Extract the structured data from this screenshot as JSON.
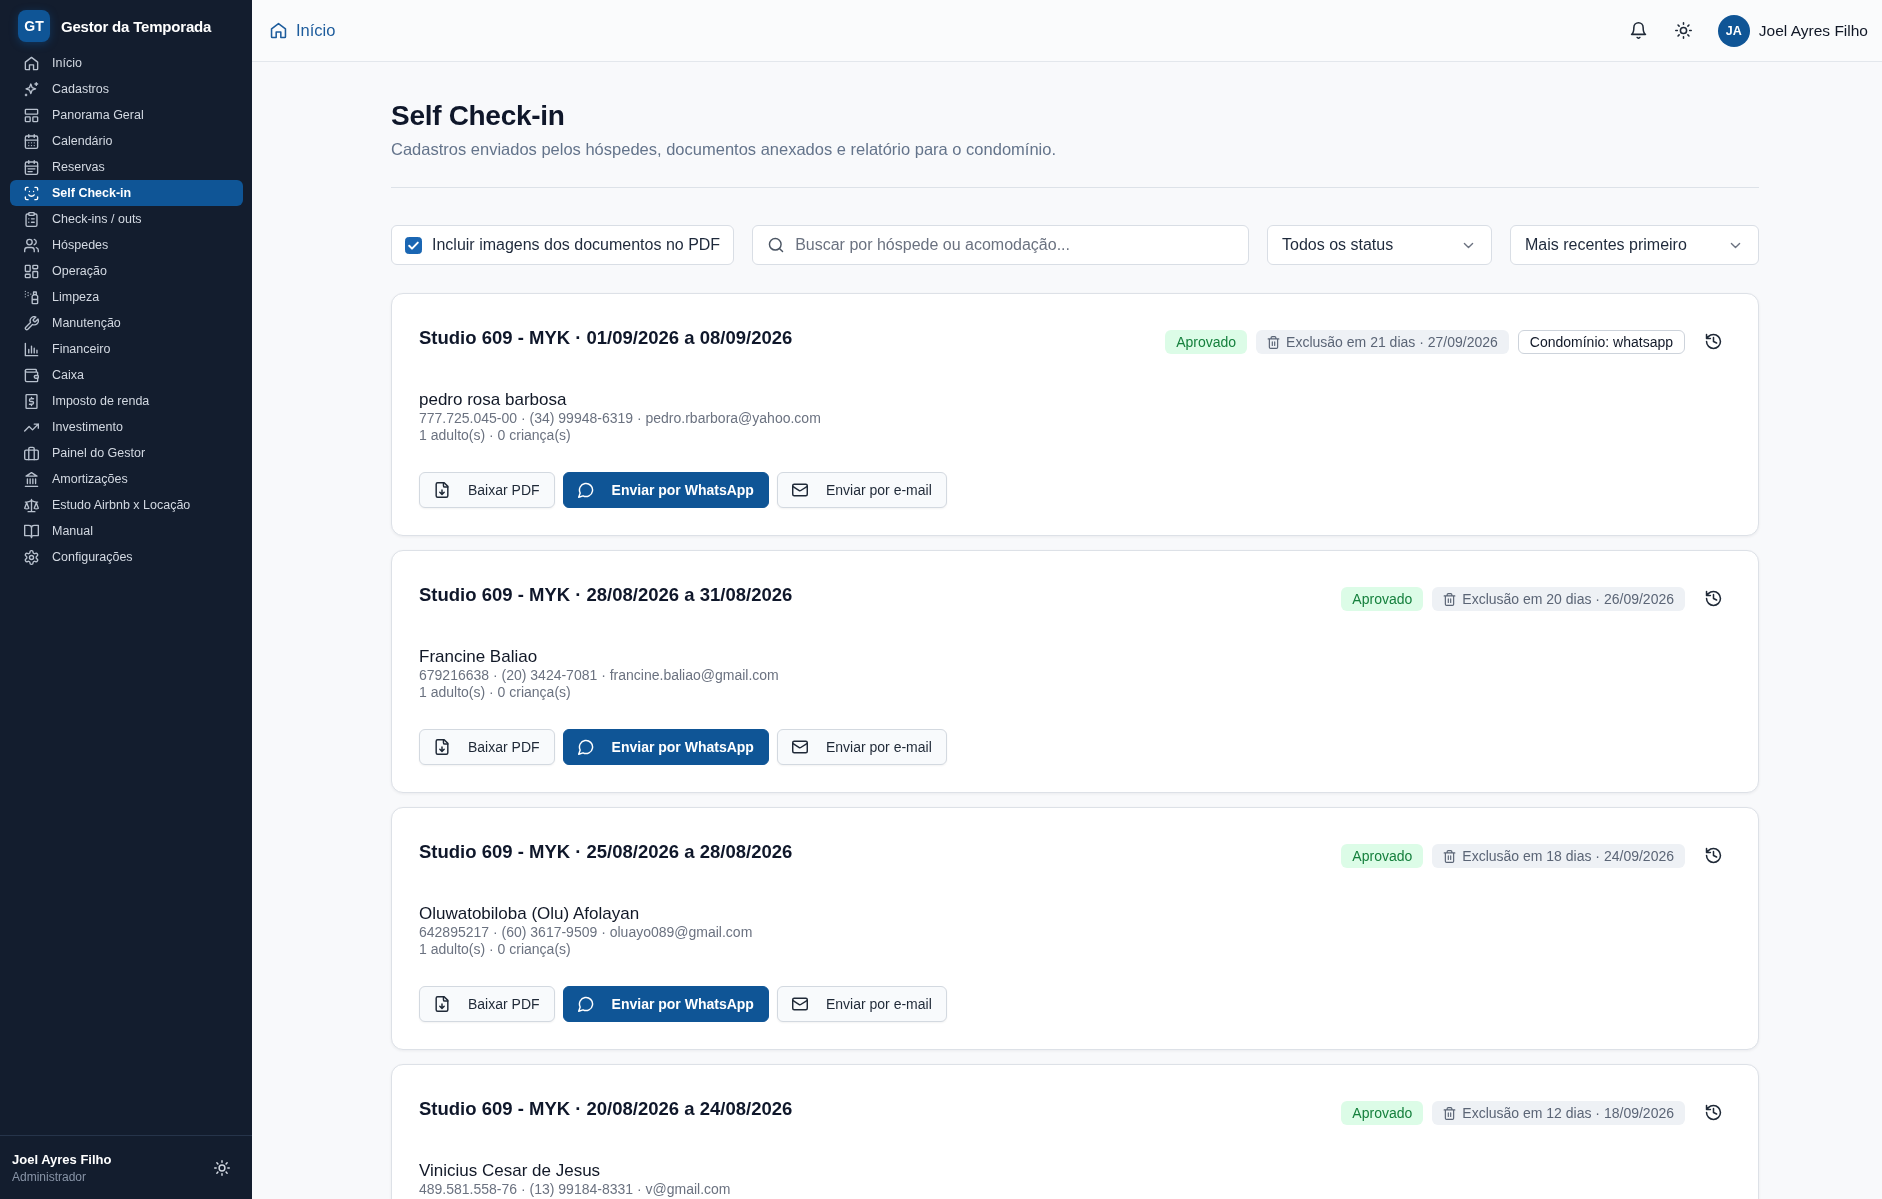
{
  "sidebar": {
    "logo": "GT",
    "title": "Gestor da Temporada",
    "items": [
      {
        "label": "Início",
        "selected": false
      },
      {
        "label": "Cadastros",
        "selected": false
      },
      {
        "label": "Panorama Geral",
        "selected": false
      },
      {
        "label": "Calendário",
        "selected": false
      },
      {
        "label": "Reservas",
        "selected": false
      },
      {
        "label": "Self Check-in",
        "selected": true
      },
      {
        "label": "Check-ins / outs",
        "selected": false
      },
      {
        "label": "Hóspedes",
        "selected": false
      },
      {
        "label": "Operação",
        "selected": false
      },
      {
        "label": "Limpeza",
        "selected": false
      },
      {
        "label": "Manutenção",
        "selected": false
      },
      {
        "label": "Financeiro",
        "selected": false
      },
      {
        "label": "Caixa",
        "selected": false
      },
      {
        "label": "Imposto de renda",
        "selected": false
      },
      {
        "label": "Investimento",
        "selected": false
      },
      {
        "label": "Painel do Gestor",
        "selected": false
      },
      {
        "label": "Amortizações",
        "selected": false
      },
      {
        "label": "Estudo Airbnb x Locação",
        "selected": false
      },
      {
        "label": "Manual",
        "selected": false
      },
      {
        "label": "Configurações",
        "selected": false
      }
    ],
    "user": {
      "name": "Joel Ayres Filho",
      "role": "Administrador"
    }
  },
  "header": {
    "breadcrumb": "Início",
    "user": {
      "initials": "JA",
      "name": "Joel Ayres Filho"
    }
  },
  "page": {
    "title": "Self Check-in",
    "subtitle": "Cadastros enviados pelos hóspedes, documentos anexados e relatório para o condomínio."
  },
  "filters": {
    "include_images": {
      "label": "Incluir imagens dos documentos no PDF",
      "checked": true
    },
    "search": {
      "placeholder": "Buscar por hóspede ou acomodação..."
    },
    "status_select": {
      "value": "Todos os status"
    },
    "sort_select": {
      "value": "Mais recentes primeiro"
    }
  },
  "cards": [
    {
      "title": "Studio 609 - MYK · 01/09/2026 a 08/09/2026",
      "badges": [
        {
          "kind": "status",
          "label": "Aprovado"
        },
        {
          "kind": "deletion",
          "label": "Exclusão em 21 dias · 27/09/2026"
        },
        {
          "kind": "condominium",
          "label": "Condomínio: whatsapp"
        }
      ],
      "guest": {
        "name": "pedro rosa barbosa",
        "details": "777.725.045-00 · (34) 99948-6319 · pedro.rbarbora@yahoo.com",
        "party": "1 adulto(s) · 0 criança(s)"
      },
      "buttons": [
        {
          "kind": "download",
          "label": "Baixar PDF"
        },
        {
          "kind": "whatsapp",
          "label": "Enviar por WhatsApp"
        },
        {
          "kind": "email",
          "label": "Enviar por e-mail"
        }
      ]
    },
    {
      "title": "Studio 609 - MYK · 28/08/2026 a 31/08/2026",
      "badges": [
        {
          "kind": "status",
          "label": "Aprovado"
        },
        {
          "kind": "deletion",
          "label": "Exclusão em 20 dias · 26/09/2026"
        }
      ],
      "guest": {
        "name": "Francine Baliao",
        "details": "679216638 · (20) 3424-7081 · francine.baliao@gmail.com",
        "party": "1 adulto(s) · 0 criança(s)"
      },
      "buttons": [
        {
          "kind": "download",
          "label": "Baixar PDF"
        },
        {
          "kind": "whatsapp",
          "label": "Enviar por WhatsApp"
        },
        {
          "kind": "email",
          "label": "Enviar por e-mail"
        }
      ]
    },
    {
      "title": "Studio 609 - MYK · 25/08/2026 a 28/08/2026",
      "badges": [
        {
          "kind": "status",
          "label": "Aprovado"
        },
        {
          "kind": "deletion",
          "label": "Exclusão em 18 dias · 24/09/2026"
        }
      ],
      "guest": {
        "name": "Oluwatobiloba (Olu) Afolayan",
        "details": "642895217 · (60) 3617-9509 · oluayo089@gmail.com",
        "party": "1 adulto(s) · 0 criança(s)"
      },
      "buttons": [
        {
          "kind": "download",
          "label": "Baixar PDF"
        },
        {
          "kind": "whatsapp",
          "label": "Enviar por WhatsApp"
        },
        {
          "kind": "email",
          "label": "Enviar por e-mail"
        }
      ]
    },
    {
      "title": "Studio 609 - MYK · 20/08/2026 a 24/08/2026",
      "badges": [
        {
          "kind": "status",
          "label": "Aprovado"
        },
        {
          "kind": "deletion",
          "label": "Exclusão em 12 dias · 18/09/2026"
        }
      ],
      "guest": {
        "name": "Vinicius Cesar de Jesus",
        "details": "489.581.558-76 · (13) 99184-8331 · v@gmail.com"
      }
    }
  ]
}
